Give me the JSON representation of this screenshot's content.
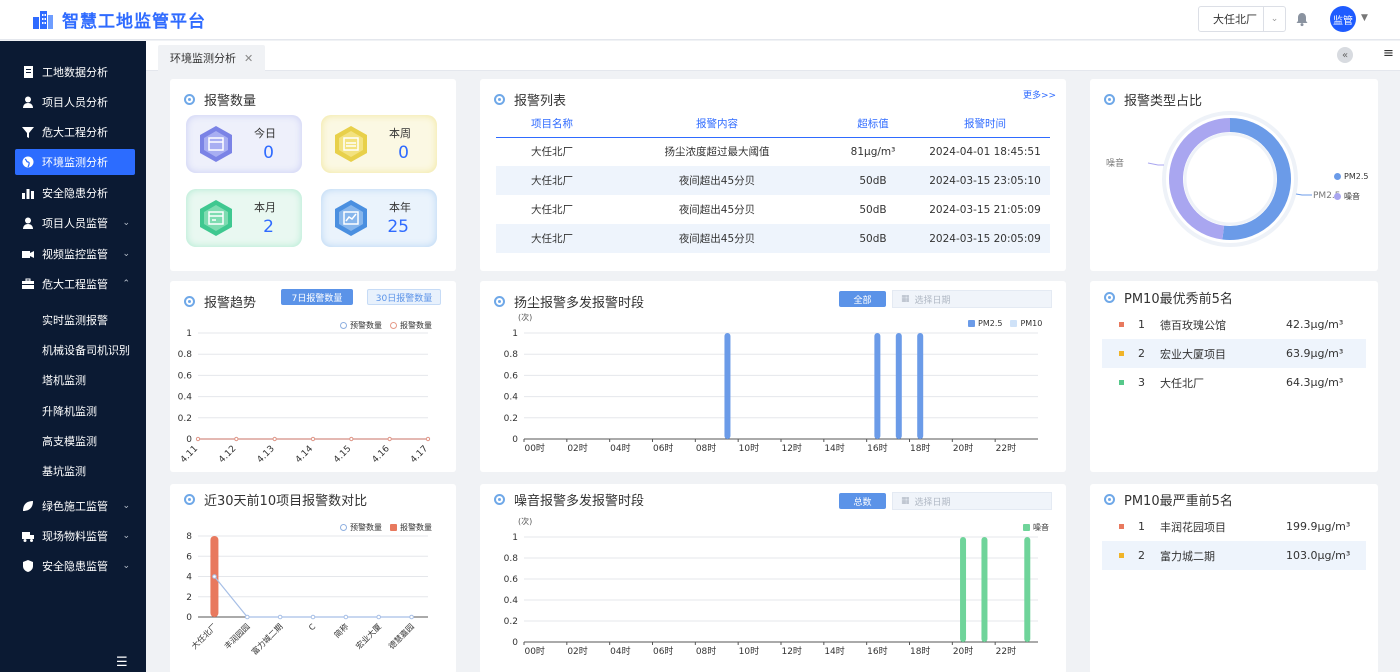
{
  "app": {
    "title": "智慧工地监管平台"
  },
  "header": {
    "site_selected": "大任北厂",
    "avatar_label": "监管"
  },
  "sidebar": {
    "items": [
      {
        "label": "工地数据分析",
        "icon": "document-icon",
        "chevron": ""
      },
      {
        "label": "项目人员分析",
        "icon": "user-icon",
        "chevron": ""
      },
      {
        "label": "危大工程分析",
        "icon": "filter-icon",
        "chevron": ""
      },
      {
        "label": "环境监测分析",
        "icon": "globe-icon",
        "chevron": ""
      },
      {
        "label": "安全隐患分析",
        "icon": "bar-chart-icon",
        "chevron": ""
      },
      {
        "label": "项目人员监管",
        "icon": "user-icon",
        "chevron": "⌄"
      },
      {
        "label": "视频监控监管",
        "icon": "video-icon",
        "chevron": "⌄"
      },
      {
        "label": "危大工程监管",
        "icon": "briefcase-icon",
        "chevron": "⌃"
      },
      {
        "label": "绿色施工监管",
        "icon": "leaf-icon",
        "chevron": "⌄"
      },
      {
        "label": "现场物料监管",
        "icon": "truck-icon",
        "chevron": "⌄"
      },
      {
        "label": "安全隐患监管",
        "icon": "shield-icon",
        "chevron": "⌄"
      }
    ],
    "sub_items": [
      "实时监测报警",
      "机械设备司机识别",
      "塔机监测",
      "升降机监测",
      "高支模监测",
      "基坑监测"
    ],
    "active_color": "#2c6cff"
  },
  "tabs": [
    {
      "label": "环境监测分析"
    }
  ],
  "alarm_count": {
    "title": "报警数量",
    "stats": [
      {
        "label": "今日",
        "value": "0",
        "color": "#7b83e6"
      },
      {
        "label": "本周",
        "value": "0",
        "color": "#e8d04a"
      },
      {
        "label": "本月",
        "value": "2",
        "color": "#3fc890"
      },
      {
        "label": "本年",
        "value": "25",
        "color": "#4a8fe0"
      }
    ]
  },
  "alarm_list": {
    "title": "报警列表",
    "more": "更多>>",
    "columns": [
      "项目名称",
      "报警内容",
      "超标值",
      "报警时间"
    ],
    "rows": [
      [
        "大任北厂",
        "扬尘浓度超过最大阈值",
        "81μg/m³",
        "2024-04-01 18:45:51"
      ],
      [
        "大任北厂",
        "夜间超出45分贝",
        "50dB",
        "2024-03-15 23:05:10"
      ],
      [
        "大任北厂",
        "夜间超出45分贝",
        "50dB",
        "2024-03-15 21:05:09"
      ],
      [
        "大任北厂",
        "夜间超出45分贝",
        "50dB",
        "2024-03-15 20:05:09"
      ]
    ]
  },
  "alarm_type": {
    "title": "报警类型占比",
    "labels": {
      "noise": "噪音",
      "pm25": "PM2.5"
    },
    "legend": [
      "PM2.5",
      "噪音"
    ],
    "colors": [
      "#6b9be8",
      "#a9a6f0"
    ]
  },
  "alarm_trend": {
    "title": "报警趋势",
    "btn_7": "7日报警数量",
    "btn_30": "30日报警数量",
    "legend": [
      "预警数量",
      "报警数量"
    ]
  },
  "dust_period": {
    "title": "扬尘报警多发报警时段",
    "btn": "全部",
    "date_placeholder": "选择日期",
    "unit": "(次)",
    "legend": [
      "PM2.5",
      "PM10"
    ]
  },
  "noise_period": {
    "title": "噪音报警多发报警时段",
    "btn": "总数",
    "date_placeholder": "选择日期",
    "unit": "(次)",
    "legend": [
      "噪音"
    ]
  },
  "top10": {
    "title": "近30天前10项目报警数对比",
    "legend": [
      "预警数量",
      "报警数量"
    ]
  },
  "pm10_best": {
    "title": "PM10最优秀前5名",
    "rows": [
      {
        "rank": "1",
        "name": "德百玫瑰公馆",
        "value": "42.3μg/m³",
        "color": "#e8795e"
      },
      {
        "rank": "2",
        "name": "宏业大厦项目",
        "value": "63.9μg/m³",
        "color": "#f0b429"
      },
      {
        "rank": "3",
        "name": "大任北厂",
        "value": "64.3μg/m³",
        "color": "#56c88a"
      }
    ]
  },
  "pm10_worst": {
    "title": "PM10最严重前5名",
    "rows": [
      {
        "rank": "1",
        "name": "丰润花园项目",
        "value": "199.9μg/m³",
        "color": "#e8795e"
      },
      {
        "rank": "2",
        "name": "富力城二期",
        "value": "103.0μg/m³",
        "color": "#f0b429"
      }
    ]
  },
  "chart_data": [
    {
      "type": "pie",
      "title": "报警类型占比",
      "categories": [
        "PM2.5",
        "噪音"
      ],
      "values": [
        13,
        12
      ]
    },
    {
      "type": "line",
      "title": "报警趋势",
      "categories": [
        "4.11",
        "4.12",
        "4.13",
        "4.14",
        "4.15",
        "4.16",
        "4.17"
      ],
      "ylim": [
        0,
        1
      ],
      "yticks": [
        "0",
        "0.2",
        "0.4",
        "0.6",
        "0.8",
        "1"
      ],
      "series": [
        {
          "name": "预警数量",
          "values": [
            0,
            0,
            0,
            0,
            0,
            0,
            0
          ]
        },
        {
          "name": "报警数量",
          "values": [
            0,
            0,
            0,
            0,
            0,
            0,
            0
          ]
        }
      ]
    },
    {
      "type": "bar",
      "title": "扬尘报警多发报警时段",
      "ylabel": "(次)",
      "ylim": [
        0,
        1
      ],
      "yticks": [
        "0",
        "0.2",
        "0.4",
        "0.6",
        "0.8",
        "1"
      ],
      "xticks": [
        "00时",
        "02时",
        "04时",
        "06时",
        "08时",
        "10时",
        "12时",
        "14时",
        "16时",
        "18时",
        "20时",
        "22时"
      ],
      "x": [
        0,
        1,
        2,
        3,
        4,
        5,
        6,
        7,
        8,
        9,
        10,
        11,
        12,
        13,
        14,
        15,
        16,
        17,
        18,
        19,
        20,
        21,
        22,
        23
      ],
      "series": [
        {
          "name": "PM2.5",
          "values": [
            0,
            0,
            0,
            0,
            0,
            0,
            0,
            0,
            0,
            1,
            0,
            0,
            0,
            0,
            0,
            0,
            1,
            1,
            1,
            0,
            0,
            0,
            0,
            0
          ]
        },
        {
          "name": "PM10",
          "values": [
            0,
            0,
            0,
            0,
            0,
            0,
            0,
            0,
            0,
            0,
            0,
            0,
            0,
            0,
            0,
            0,
            0,
            0,
            0,
            0,
            0,
            0,
            0,
            0
          ]
        }
      ]
    },
    {
      "type": "bar",
      "title": "噪音报警多发报警时段",
      "ylabel": "(次)",
      "ylim": [
        0,
        1
      ],
      "yticks": [
        "0",
        "0.2",
        "0.4",
        "0.6",
        "0.8",
        "1"
      ],
      "xticks": [
        "00时",
        "02时",
        "04时",
        "06时",
        "08时",
        "10时",
        "12时",
        "14时",
        "16时",
        "18时",
        "20时",
        "22时"
      ],
      "x": [
        0,
        1,
        2,
        3,
        4,
        5,
        6,
        7,
        8,
        9,
        10,
        11,
        12,
        13,
        14,
        15,
        16,
        17,
        18,
        19,
        20,
        21,
        22,
        23
      ],
      "series": [
        {
          "name": "噪音",
          "values": [
            0,
            0,
            0,
            0,
            0,
            0,
            0,
            0,
            0,
            0,
            0,
            0,
            0,
            0,
            0,
            0,
            0,
            0,
            0,
            0,
            1,
            1,
            0,
            1
          ]
        }
      ]
    },
    {
      "type": "bar",
      "title": "近30天前10项目报警数对比",
      "categories": [
        "大任北厂",
        "丰润园园",
        "富力城二期",
        "C",
        "简称",
        "宏业大厦",
        "德慧嘉园"
      ],
      "ylim": [
        0,
        8
      ],
      "yticks": [
        "0",
        "2",
        "4",
        "6",
        "8"
      ],
      "series": [
        {
          "name": "预警数量",
          "values": [
            4,
            0,
            0,
            0,
            0,
            0,
            0
          ]
        },
        {
          "name": "报警数量",
          "values": [
            8,
            0,
            0,
            0,
            0,
            0,
            0
          ]
        }
      ]
    }
  ]
}
